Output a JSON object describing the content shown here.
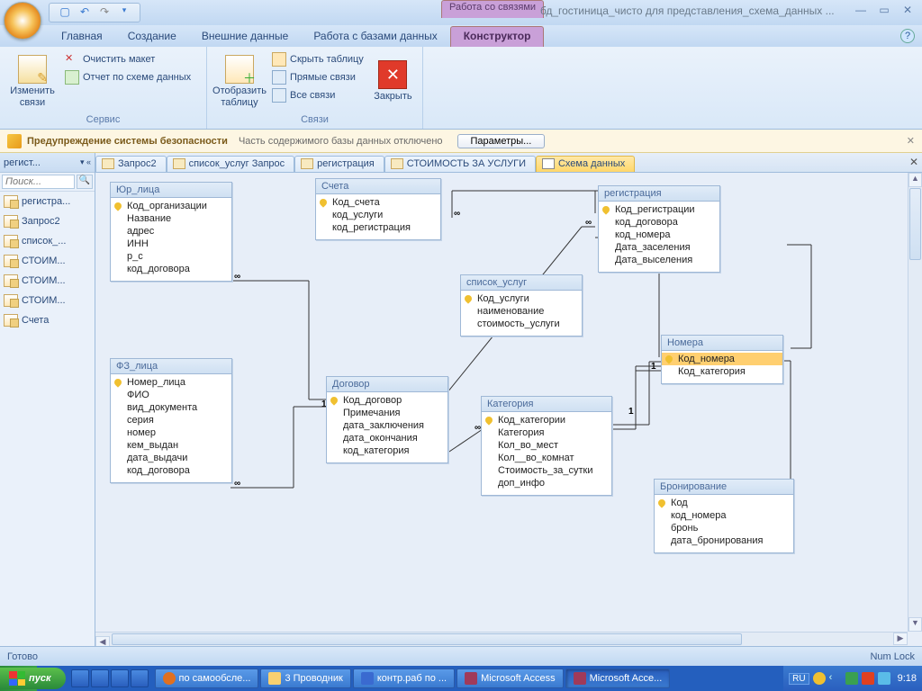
{
  "title": {
    "context": "Работа со связями",
    "file": "бд_гостиница_чисто для представления_схема_данных ..."
  },
  "tabs": {
    "main": "Главная",
    "create": "Создание",
    "external": "Внешние данные",
    "dbwork": "Работа с базами данных",
    "designer": "Конструктор"
  },
  "ribbon": {
    "group_service": "Сервис",
    "group_links": "Связи",
    "edit_links": "Изменить связи",
    "clear_layout": "Очистить макет",
    "schema_report": "Отчет по схеме данных",
    "show_table": "Отобразить таблицу",
    "hide_table": "Скрыть таблицу",
    "direct_links": "Прямые связи",
    "all_links": "Все связи",
    "close": "Закрыть"
  },
  "security": {
    "title": "Предупреждение системы безопасности",
    "msg": "Часть содержимого базы данных отключено",
    "params": "Параметры..."
  },
  "nav": {
    "header": "регист...",
    "search": "Поиск...",
    "items": [
      "регистра...",
      "Запрос2",
      "список_...",
      "СТОИМ...",
      "СТОИМ...",
      "СТОИМ...",
      "Счета"
    ]
  },
  "doctabs": {
    "t0": "Запрос2",
    "t1": "список_услуг Запрос",
    "t2": "регистрация",
    "t3": "СТОИМОСТЬ ЗА УСЛУГИ",
    "t4": "Схема данных"
  },
  "tables": {
    "yur": {
      "title": "Юр_лица",
      "f0": "Код_организации",
      "f1": "Название",
      "f2": "адрес",
      "f3": "ИНН",
      "f4": "р_с",
      "f5": "код_договора"
    },
    "fz": {
      "title": "ФЗ_лица",
      "f0": "Номер_лица",
      "f1": "ФИО",
      "f2": "вид_документа",
      "f3": "серия",
      "f4": "номер",
      "f5": "кем_выдан",
      "f6": "дата_выдачи",
      "f7": "код_договора"
    },
    "scheta": {
      "title": "Счета",
      "f0": "Код_счета",
      "f1": "код_услуги",
      "f2": "код_регистрация"
    },
    "dogovor": {
      "title": "Договор",
      "f0": "Код_договор",
      "f1": "Примечания",
      "f2": "дата_заключения",
      "f3": "дата_окончания",
      "f4": "код_категория"
    },
    "uslugi": {
      "title": "список_услуг",
      "f0": "Код_услуги",
      "f1": "наименование",
      "f2": "стоимость_услуги"
    },
    "kategoria": {
      "title": "Категория",
      "f0": "Код_категории",
      "f1": "Категория",
      "f2": "Кол_во_мест",
      "f3": "Кол__во_комнат",
      "f4": "Стоимость_за_сутки",
      "f5": "доп_инфо"
    },
    "reg": {
      "title": "регистрация",
      "f0": "Код_регистрации",
      "f1": "код_договора",
      "f2": "код_номера",
      "f3": "Дата_заселения",
      "f4": "Дата_выселения"
    },
    "nomera": {
      "title": "Номера",
      "f0": "Код_номера",
      "f1": "Код_категория"
    },
    "bron": {
      "title": "Бронирование",
      "f0": "Код",
      "f1": "код_номера",
      "f2": "бронь",
      "f3": "дата_бронирования"
    }
  },
  "status": {
    "ready": "Готово",
    "numlock": "Num Lock"
  },
  "taskbar": {
    "start": "пуск",
    "t0": "по самообсле...",
    "t1": "3 Проводник",
    "t2": "контр.раб по ...",
    "t3": "Microsoft Access",
    "t4": "Microsoft Acce...",
    "lang": "RU",
    "clock": "9:18"
  }
}
